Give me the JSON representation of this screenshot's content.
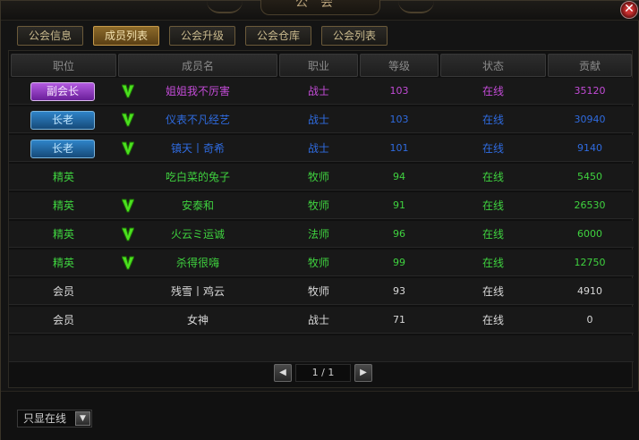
{
  "window": {
    "title": "公会",
    "close_glyph": "✕"
  },
  "tabs": [
    "公会信息",
    "成员列表",
    "公会升级",
    "公会仓库",
    "公会列表"
  ],
  "active_tab": 1,
  "columns": [
    "职位",
    "成员名",
    "职业",
    "等级",
    "状态",
    "贡献"
  ],
  "members": [
    {
      "position": "副会长",
      "badge": "purple",
      "vip": true,
      "name": "姐姐我不厉害",
      "class": "战士",
      "level": "103",
      "status": "在线",
      "contribution": "35120",
      "color": "#c24bd6"
    },
    {
      "position": "长老",
      "badge": "blue",
      "vip": true,
      "name": "仪表不凡经艺",
      "class": "战士",
      "level": "103",
      "status": "在线",
      "contribution": "30940",
      "color": "#2f6be0"
    },
    {
      "position": "长老",
      "badge": "blue",
      "vip": true,
      "name": "镇天丨奇希",
      "class": "战士",
      "level": "101",
      "status": "在线",
      "contribution": "9140",
      "color": "#2f6be0"
    },
    {
      "position": "精英",
      "badge": "",
      "vip": false,
      "name": "吃白菜的兔子",
      "class": "牧师",
      "level": "94",
      "status": "在线",
      "contribution": "5450",
      "color": "#3fd23f"
    },
    {
      "position": "精英",
      "badge": "",
      "vip": true,
      "name": "安泰和",
      "class": "牧师",
      "level": "91",
      "status": "在线",
      "contribution": "26530",
      "color": "#3fd23f"
    },
    {
      "position": "精英",
      "badge": "",
      "vip": true,
      "name": "火云ミ运诚",
      "class": "法师",
      "level": "96",
      "status": "在线",
      "contribution": "6000",
      "color": "#3fd23f"
    },
    {
      "position": "精英",
      "badge": "",
      "vip": true,
      "name": "杀得很嗨",
      "class": "牧师",
      "level": "99",
      "status": "在线",
      "contribution": "12750",
      "color": "#3fd23f"
    },
    {
      "position": "会员",
      "badge": "",
      "vip": false,
      "name": "残雪丨鸡云",
      "class": "牧师",
      "level": "93",
      "status": "在线",
      "contribution": "4910",
      "color": "#d8d8d8"
    },
    {
      "position": "会员",
      "badge": "",
      "vip": false,
      "name": "女神",
      "class": "战士",
      "level": "71",
      "status": "在线",
      "contribution": "0",
      "color": "#d8d8d8"
    }
  ],
  "pager": {
    "text": "1 / 1",
    "prev_icon": "triangle-left-icon",
    "next_icon": "triangle-right-icon"
  },
  "filter": {
    "label": "只显在线",
    "dropdown_icon": "triangle-down-icon"
  }
}
